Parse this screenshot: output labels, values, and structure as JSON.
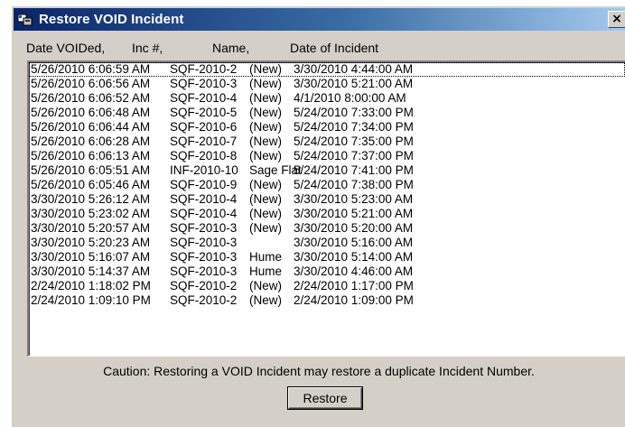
{
  "window": {
    "title": "Restore VOID Incident",
    "close_glyph": "×",
    "app_icon": "dispatch-app-icon"
  },
  "columns": {
    "date_voided": "Date VOIDed,",
    "inc_num": "Inc #,",
    "name": "Name,",
    "date_of_incident": "Date of Incident"
  },
  "rows": [
    {
      "voided": "5/26/2010 6:06:59 AM",
      "inc": "SQF-2010-2",
      "name": "(New)",
      "incident": "3/30/2010 4:44:00 AM"
    },
    {
      "voided": "5/26/2010 6:06:56 AM",
      "inc": "SQF-2010-3",
      "name": "(New)",
      "incident": "3/30/2010 5:21:00 AM"
    },
    {
      "voided": "5/26/2010 6:06:52 AM",
      "inc": "SQF-2010-4",
      "name": "(New)",
      "incident": "4/1/2010 8:00:00 AM"
    },
    {
      "voided": "5/26/2010 6:06:48 AM",
      "inc": "SQF-2010-5",
      "name": "(New)",
      "incident": "5/24/2010 7:33:00 PM"
    },
    {
      "voided": "5/26/2010 6:06:44 AM",
      "inc": "SQF-2010-6",
      "name": "(New)",
      "incident": "5/24/2010 7:34:00 PM"
    },
    {
      "voided": "5/26/2010 6:06:28 AM",
      "inc": "SQF-2010-7",
      "name": "(New)",
      "incident": "5/24/2010 7:35:00 PM"
    },
    {
      "voided": "5/26/2010 6:06:13 AM",
      "inc": "SQF-2010-8",
      "name": "(New)",
      "incident": "5/24/2010 7:37:00 PM"
    },
    {
      "voided": "5/26/2010 6:05:51 AM",
      "inc": "INF-2010-10",
      "name": "Sage Flat",
      "incident": "5/24/2010 7:41:00 PM"
    },
    {
      "voided": "5/26/2010 6:05:46 AM",
      "inc": "SQF-2010-9",
      "name": "(New)",
      "incident": "5/24/2010 7:38:00 PM"
    },
    {
      "voided": "3/30/2010 5:26:12 AM",
      "inc": "SQF-2010-4",
      "name": "(New)",
      "incident": "3/30/2010 5:23:00 AM"
    },
    {
      "voided": "3/30/2010 5:23:02 AM",
      "inc": "SQF-2010-4",
      "name": "(New)",
      "incident": "3/30/2010 5:21:00 AM"
    },
    {
      "voided": "3/30/2010 5:20:57 AM",
      "inc": "SQF-2010-3",
      "name": "(New)",
      "incident": "3/30/2010 5:20:00 AM"
    },
    {
      "voided": "3/30/2010 5:20:23 AM",
      "inc": "SQF-2010-3",
      "name": "",
      "incident": "3/30/2010 5:16:00 AM"
    },
    {
      "voided": "3/30/2010 5:16:07 AM",
      "inc": "SQF-2010-3",
      "name": "Hume",
      "incident": "3/30/2010 5:14:00 AM"
    },
    {
      "voided": "3/30/2010 5:14:37 AM",
      "inc": "SQF-2010-3",
      "name": "Hume",
      "incident": "3/30/2010 4:46:00 AM"
    },
    {
      "voided": "2/24/2010 1:18:02 PM",
      "inc": "SQF-2010-2",
      "name": "(New)",
      "incident": "2/24/2010 1:17:00 PM"
    },
    {
      "voided": "2/24/2010 1:09:10 PM",
      "inc": "SQF-2010-2",
      "name": "(New)",
      "incident": "2/24/2010 1:09:00 PM"
    }
  ],
  "caution": "Caution: Restoring a VOID Incident may restore a duplicate Incident Number.",
  "restore_label": "Restore",
  "colors": {
    "titlebar_start": "#0a246a",
    "titlebar_end": "#a6caf0",
    "dialog_face": "#d4d0c8",
    "list_bg": "#ffffff"
  }
}
